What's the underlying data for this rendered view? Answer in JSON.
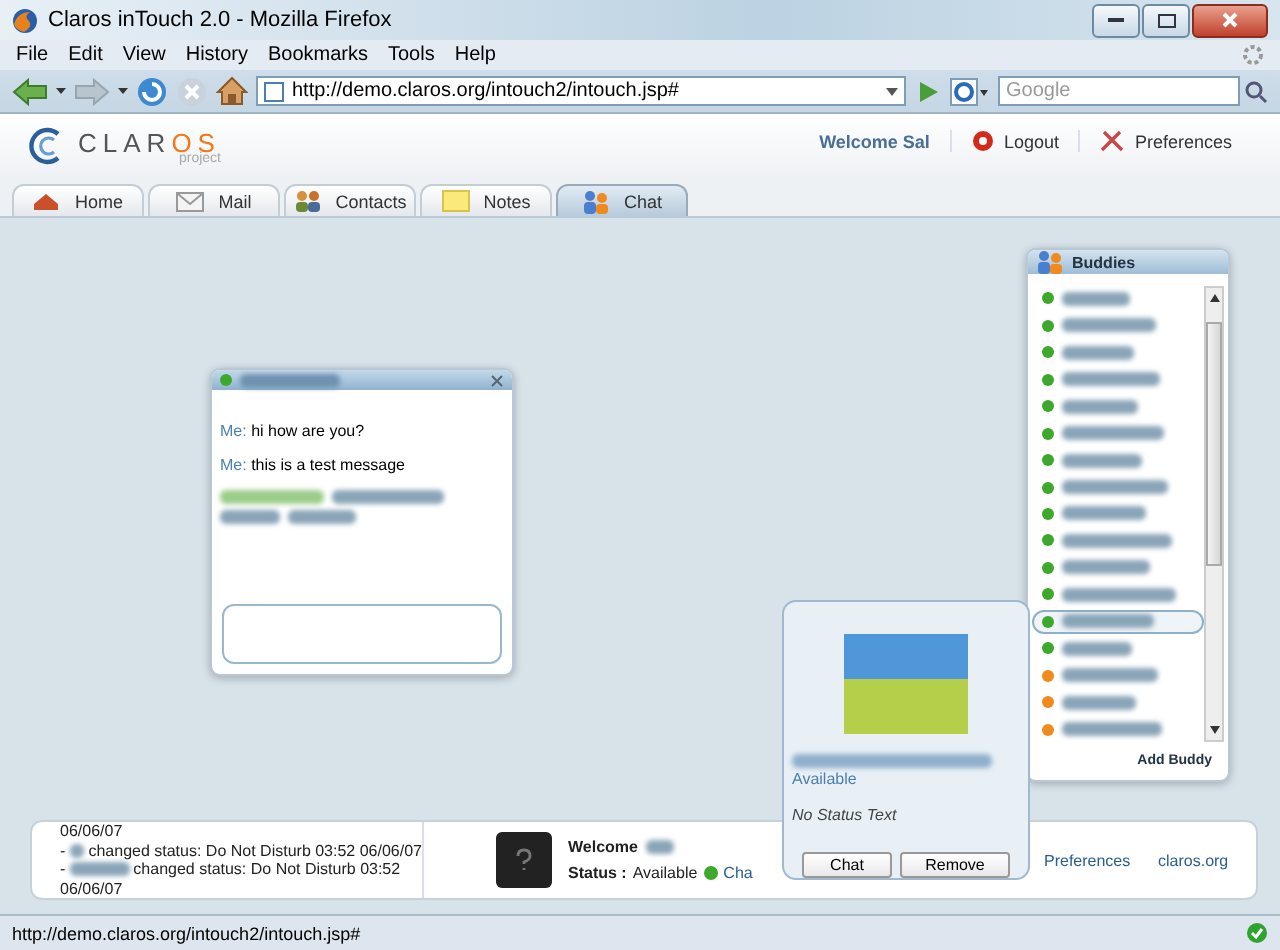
{
  "window": {
    "title": "Claros inTouch 2.0 - Mozilla Firefox"
  },
  "menu": [
    {
      "label": "File"
    },
    {
      "label": "Edit"
    },
    {
      "label": "View"
    },
    {
      "label": "History"
    },
    {
      "label": "Bookmarks"
    },
    {
      "label": "Tools"
    },
    {
      "label": "Help"
    }
  ],
  "address": {
    "value": "http://demo.claros.org/intouch2/intouch.jsp#"
  },
  "search": {
    "placeholder": "Google"
  },
  "header": {
    "logo_main": "CLAR",
    "logo_accent": "OS",
    "logo_sub": "project",
    "welcome": "Welcome Sal",
    "logout": "Logout",
    "preferences": "Preferences"
  },
  "tabs": [
    {
      "label": "Home",
      "kind": "home",
      "selected": false
    },
    {
      "label": "Mail",
      "kind": "mail",
      "selected": false
    },
    {
      "label": "Contacts",
      "kind": "contacts",
      "selected": false
    },
    {
      "label": "Notes",
      "kind": "notes",
      "selected": false
    },
    {
      "label": "Chat",
      "kind": "chat",
      "selected": true
    }
  ],
  "chat_window": {
    "messages": [
      {
        "sender": "Me:",
        "text": "hi how are you?"
      },
      {
        "sender": "Me:",
        "text": "this is a test message"
      }
    ]
  },
  "buddies": {
    "title": "Buddies",
    "add": "Add Buddy",
    "items": [
      {
        "color": "#3ea82c",
        "selected": false
      },
      {
        "color": "#3ea82c",
        "selected": false
      },
      {
        "color": "#3ea82c",
        "selected": false
      },
      {
        "color": "#3ea82c",
        "selected": false
      },
      {
        "color": "#3ea82c",
        "selected": false
      },
      {
        "color": "#3ea82c",
        "selected": false
      },
      {
        "color": "#3ea82c",
        "selected": false
      },
      {
        "color": "#3ea82c",
        "selected": false
      },
      {
        "color": "#3ea82c",
        "selected": false
      },
      {
        "color": "#3ea82c",
        "selected": false
      },
      {
        "color": "#3ea82c",
        "selected": false
      },
      {
        "color": "#3ea82c",
        "selected": false
      },
      {
        "color": "#3ea82c",
        "selected": true
      },
      {
        "color": "#3ea82c",
        "selected": false
      },
      {
        "color": "#f08a1c",
        "selected": false
      },
      {
        "color": "#f08a1c",
        "selected": false
      },
      {
        "color": "#f08a1c",
        "selected": false
      }
    ]
  },
  "popup": {
    "status": "Available",
    "status_text": "No Status Text",
    "buttons": [
      "Chat",
      "Remove"
    ]
  },
  "info_bar": {
    "log": [
      {
        "kind": "continuation",
        "text": "06/06/07"
      },
      {
        "kind": "entry",
        "prefix": "-",
        "text": "changed status: Do Not Disturb 03:52 06/06/07"
      },
      {
        "kind": "entry",
        "prefix": "-",
        "text": "changed status: Do Not Disturb 03:52"
      },
      {
        "kind": "continuation",
        "text": "06/06/07"
      }
    ],
    "welcome": "Welcome",
    "status_label": "Status :",
    "status": "Available",
    "chat_link": "Cha",
    "preferences": "Preferences",
    "site": "claros.org"
  },
  "status_bar": {
    "text": "http://demo.claros.org/intouch2/intouch.jsp#"
  }
}
